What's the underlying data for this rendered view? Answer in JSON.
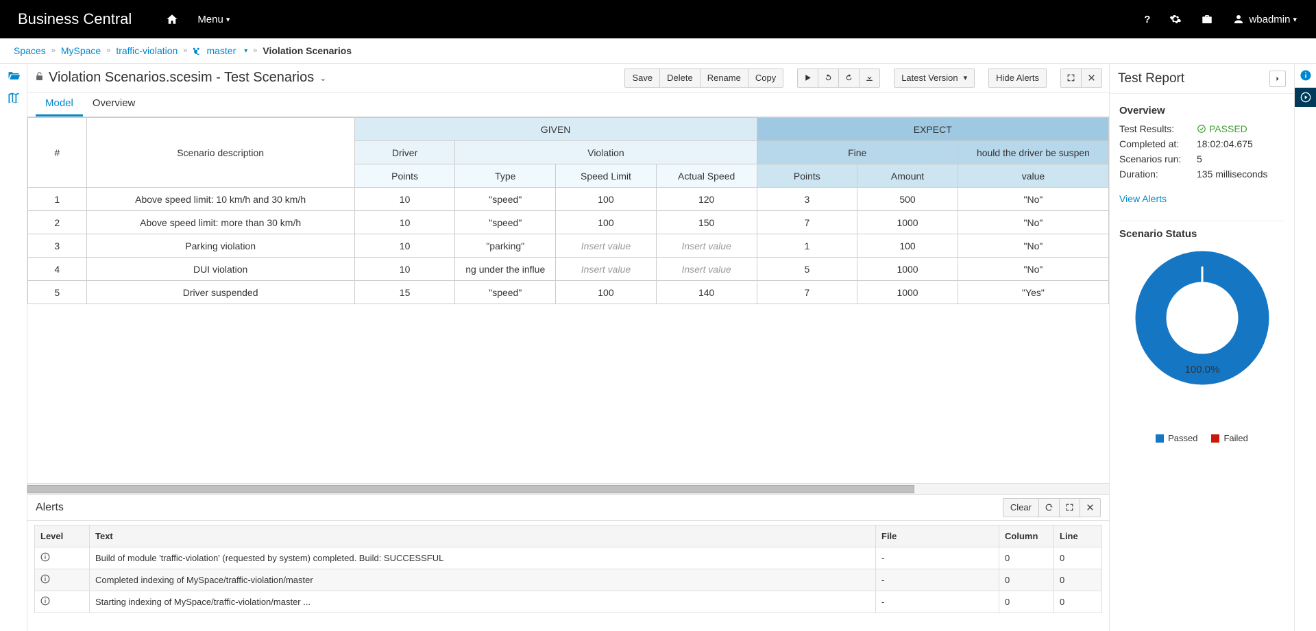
{
  "navbar": {
    "brand": "Business Central",
    "menu": "Menu",
    "user": "wbadmin"
  },
  "breadcrumb": {
    "spaces": "Spaces",
    "space": "MySpace",
    "project": "traffic-violation",
    "branch": "master",
    "current": "Violation Scenarios"
  },
  "editor": {
    "title": "Violation Scenarios.scesim - Test Scenarios",
    "toolbar": {
      "save": "Save",
      "delete": "Delete",
      "rename": "Rename",
      "copy": "Copy",
      "latest_version": "Latest Version",
      "hide_alerts": "Hide Alerts"
    },
    "tabs": {
      "model": "Model",
      "overview": "Overview"
    }
  },
  "grid": {
    "hash": "#",
    "desc": "Scenario description",
    "given": "GIVEN",
    "expect": "EXPECT",
    "driver": "Driver",
    "violation": "Violation",
    "fine": "Fine",
    "suspend": "hould the driver be suspen",
    "points": "Points",
    "type": "Type",
    "speed_limit": "Speed Limit",
    "actual_speed": "Actual Speed",
    "amount": "Amount",
    "value": "value",
    "insert": "Insert value",
    "rows": [
      {
        "n": "1",
        "desc": "Above speed limit: 10 km/h and 30 km/h",
        "dp": "10",
        "type": "\"speed\"",
        "sl": "100",
        "as": "120",
        "fp": "3",
        "amt": "500",
        "sv": "\"No\""
      },
      {
        "n": "2",
        "desc": "Above speed limit: more than 30 km/h",
        "dp": "10",
        "type": "\"speed\"",
        "sl": "100",
        "as": "150",
        "fp": "7",
        "amt": "1000",
        "sv": "\"No\""
      },
      {
        "n": "3",
        "desc": "Parking violation",
        "dp": "10",
        "type": "\"parking\"",
        "sl": "",
        "as": "",
        "fp": "1",
        "amt": "100",
        "sv": "\"No\""
      },
      {
        "n": "4",
        "desc": "DUI violation",
        "dp": "10",
        "type": "ng under the influe",
        "sl": "",
        "as": "",
        "fp": "5",
        "amt": "1000",
        "sv": "\"No\""
      },
      {
        "n": "5",
        "desc": "Driver suspended",
        "dp": "15",
        "type": "\"speed\"",
        "sl": "100",
        "as": "140",
        "fp": "7",
        "amt": "1000",
        "sv": "\"Yes\""
      }
    ]
  },
  "alerts": {
    "title": "Alerts",
    "clear": "Clear",
    "cols": {
      "level": "Level",
      "text": "Text",
      "file": "File",
      "column": "Column",
      "line": "Line"
    },
    "rows": [
      {
        "text": "Build of module 'traffic-violation' (requested by system) completed. Build: SUCCESSFUL",
        "file": "-",
        "col": "0",
        "line": "0"
      },
      {
        "text": "Completed indexing of MySpace/traffic-violation/master",
        "file": "-",
        "col": "0",
        "line": "0"
      },
      {
        "text": "Starting indexing of MySpace/traffic-violation/master ...",
        "file": "-",
        "col": "0",
        "line": "0"
      }
    ]
  },
  "report": {
    "title": "Test Report",
    "overview": "Overview",
    "results_label": "Test Results:",
    "results_value": "PASSED",
    "completed_label": "Completed at:",
    "completed_value": "18:02:04.675",
    "scenarios_label": "Scenarios run:",
    "scenarios_value": "5",
    "duration_label": "Duration:",
    "duration_value": "135 milliseconds",
    "view_alerts": "View Alerts",
    "status_title": "Scenario Status",
    "donut_label": "100.0%",
    "legend_passed": "Passed",
    "legend_failed": "Failed"
  },
  "chart_data": {
    "type": "pie",
    "title": "Scenario Status",
    "series": [
      {
        "name": "Passed",
        "value": 100.0,
        "color": "#1576c4"
      },
      {
        "name": "Failed",
        "value": 0.0,
        "color": "#c9190b"
      }
    ],
    "donut": true,
    "center_label": "100.0%"
  }
}
